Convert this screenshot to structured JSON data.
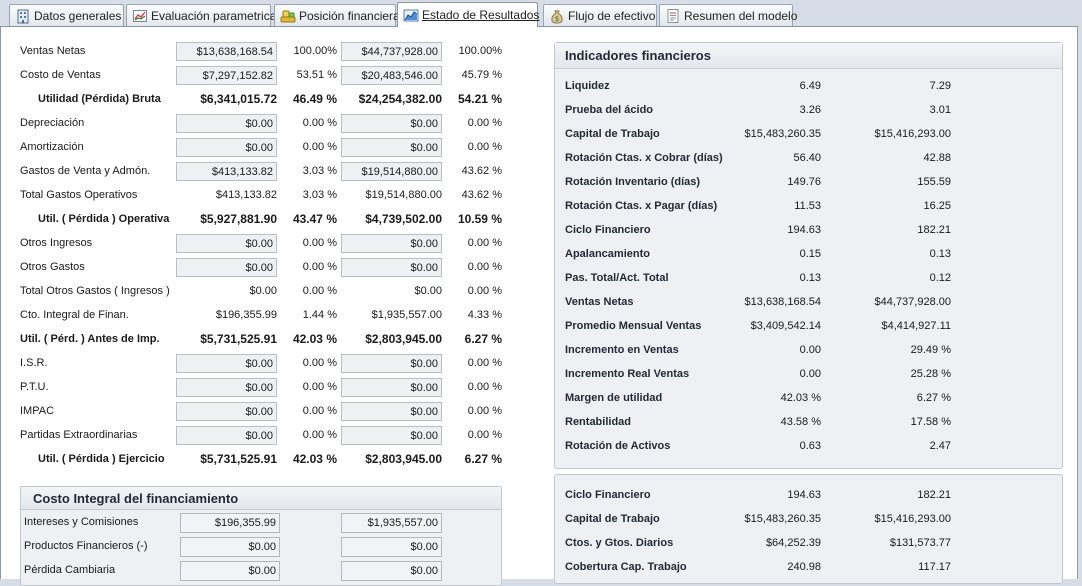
{
  "tabs": [
    {
      "label": "Datos generales",
      "icon": "building-icon"
    },
    {
      "label": "Evaluación parametrica",
      "icon": "chart-icon"
    },
    {
      "label": "Posición financiera",
      "icon": "scales-icon"
    },
    {
      "label": "Estado de Resultados",
      "icon": "line-chart-icon",
      "active": true
    },
    {
      "label": "Flujo de efectivo",
      "icon": "money-bag-icon"
    },
    {
      "label": "Resumen del modelo",
      "icon": "document-icon"
    }
  ],
  "results": [
    {
      "label": "Ventas Netas",
      "v1": "$13,638,168.54",
      "p1": "100.00%",
      "v2": "$44,737,928.00",
      "p2": "100.00%",
      "kind": "input"
    },
    {
      "label": "Costo de Ventas",
      "v1": "$7,297,152.82",
      "p1": "53.51 %",
      "v2": "$20,483,546.00",
      "p2": "45.79 %",
      "kind": "input"
    },
    {
      "label": "Utilidad (Pérdida) Bruta",
      "v1": "$6,341,015.72",
      "p1": "46.49 %",
      "v2": "$24,254,382.00",
      "p2": "54.21 %",
      "kind": "bold"
    },
    {
      "label": "Depreciación",
      "v1": "$0.00",
      "p1": "0.00 %",
      "v2": "$0.00",
      "p2": "0.00 %",
      "kind": "input"
    },
    {
      "label": "Amortización",
      "v1": "$0.00",
      "p1": "0.00 %",
      "v2": "$0.00",
      "p2": "0.00 %",
      "kind": "input"
    },
    {
      "label": "Gastos de Venta y Admón.",
      "v1": "$413,133.82",
      "p1": "3.03 %",
      "v2": "$19,514,880.00",
      "p2": "43.62 %",
      "kind": "input"
    },
    {
      "label": "Total Gastos Operativos",
      "v1": "$413,133.82",
      "p1": "3.03 %",
      "v2": "$19,514,880.00",
      "p2": "43.62 %",
      "kind": "plain"
    },
    {
      "label": "Util. ( Pérdida ) Operativa",
      "v1": "$5,927,881.90",
      "p1": "43.47 %",
      "v2": "$4,739,502.00",
      "p2": "10.59 %",
      "kind": "bold"
    },
    {
      "label": "Otros Ingresos",
      "v1": "$0.00",
      "p1": "0.00 %",
      "v2": "$0.00",
      "p2": "0.00 %",
      "kind": "input"
    },
    {
      "label": "Otros Gastos",
      "v1": "$0.00",
      "p1": "0.00 %",
      "v2": "$0.00",
      "p2": "0.00 %",
      "kind": "input"
    },
    {
      "label": "Total Otros Gastos ( Ingresos )",
      "v1": "$0.00",
      "p1": "0.00 %",
      "v2": "$0.00",
      "p2": "0.00 %",
      "kind": "plain"
    },
    {
      "label": "Cto. Integral de Finan.",
      "v1": "$196,355.99",
      "p1": "1.44 %",
      "v2": "$1,935,557.00",
      "p2": "4.33 %",
      "kind": "plain"
    },
    {
      "label": "Util. ( Pérd. ) Antes de Imp.",
      "v1": "$5,731,525.91",
      "p1": "42.03 %",
      "v2": "$2,803,945.00",
      "p2": "6.27 %",
      "kind": "bold-left"
    },
    {
      "label": "I.S.R.",
      "v1": "$0.00",
      "p1": "0.00 %",
      "v2": "$0.00",
      "p2": "0.00 %",
      "kind": "input"
    },
    {
      "label": "P.T.U.",
      "v1": "$0.00",
      "p1": "0.00 %",
      "v2": "$0.00",
      "p2": "0.00 %",
      "kind": "input"
    },
    {
      "label": "IMPAC",
      "v1": "$0.00",
      "p1": "0.00 %",
      "v2": "$0.00",
      "p2": "0.00 %",
      "kind": "input"
    },
    {
      "label": "Partidas Extraordinarias",
      "v1": "$0.00",
      "p1": "0.00 %",
      "v2": "$0.00",
      "p2": "0.00 %",
      "kind": "input"
    },
    {
      "label": "Util. ( Pérdida ) Ejercicio",
      "v1": "$5,731,525.91",
      "p1": "42.03 %",
      "v2": "$2,803,945.00",
      "p2": "6.27 %",
      "kind": "bold"
    }
  ],
  "costo_integral": {
    "title": "Costo Integral del financiamiento",
    "rows": [
      {
        "label": "Intereses y Comisiones",
        "v1": "$196,355.99",
        "v2": "$1,935,557.00"
      },
      {
        "label": "Productos Financieros (-)",
        "v1": "$0.00",
        "v2": "$0.00"
      },
      {
        "label": "Pérdida Cambiaria",
        "v1": "$0.00",
        "v2": "$0.00"
      }
    ]
  },
  "indicadores": {
    "title": "Indicadores financieros",
    "rows": [
      {
        "label": "Liquidez",
        "a": "6.49",
        "b": "7.29"
      },
      {
        "label": "Prueba del ácido",
        "a": "3.26",
        "b": "3.01"
      },
      {
        "label": "Capital de Trabajo",
        "a": "$15,483,260.35",
        "b": "$15,416,293.00"
      },
      {
        "label": "Rotación Ctas. x Cobrar (días)",
        "a": "56.40",
        "b": "42.88"
      },
      {
        "label": "Rotación Inventario (días)",
        "a": "149.76",
        "b": "155.59"
      },
      {
        "label": "Rotación Ctas. x Pagar (días)",
        "a": "11.53",
        "b": "16.25"
      },
      {
        "label": "Ciclo Financiero",
        "a": "194.63",
        "b": "182.21"
      },
      {
        "label": "Apalancamiento",
        "a": "0.15",
        "b": "0.13"
      },
      {
        "label": "Pas. Total/Act. Total",
        "a": "0.13",
        "b": "0.12"
      },
      {
        "label": "Ventas Netas",
        "a": "$13,638,168.54",
        "b": "$44,737,928.00"
      },
      {
        "label": "Promedio Mensual Ventas",
        "a": "$3,409,542.14",
        "b": "$4,414,927.11"
      },
      {
        "label": "Incremento en Ventas",
        "a": "0.00",
        "b": "29.49 %"
      },
      {
        "label": "Incremento Real Ventas",
        "a": "0.00",
        "b": "25.28 %"
      },
      {
        "label": "Margen de utilidad",
        "a": "42.03 %",
        "b": "6.27 %"
      },
      {
        "label": "Rentabilidad",
        "a": "43.58 %",
        "b": "17.58 %"
      },
      {
        "label": "Rotación de Activos",
        "a": "0.63",
        "b": "2.47"
      }
    ]
  },
  "resumen": {
    "rows": [
      {
        "label": "Ciclo Financiero",
        "a": "194.63",
        "b": "182.21"
      },
      {
        "label": "Capital de Trabajo",
        "a": "$15,483,260.35",
        "b": "$15,416,293.00"
      },
      {
        "label": "Ctos. y Gtos. Diarios",
        "a": "$64,252.39",
        "b": "$131,573.77"
      },
      {
        "label": "Cobertura Cap. Trabajo",
        "a": "240.98",
        "b": "117.17"
      }
    ]
  }
}
